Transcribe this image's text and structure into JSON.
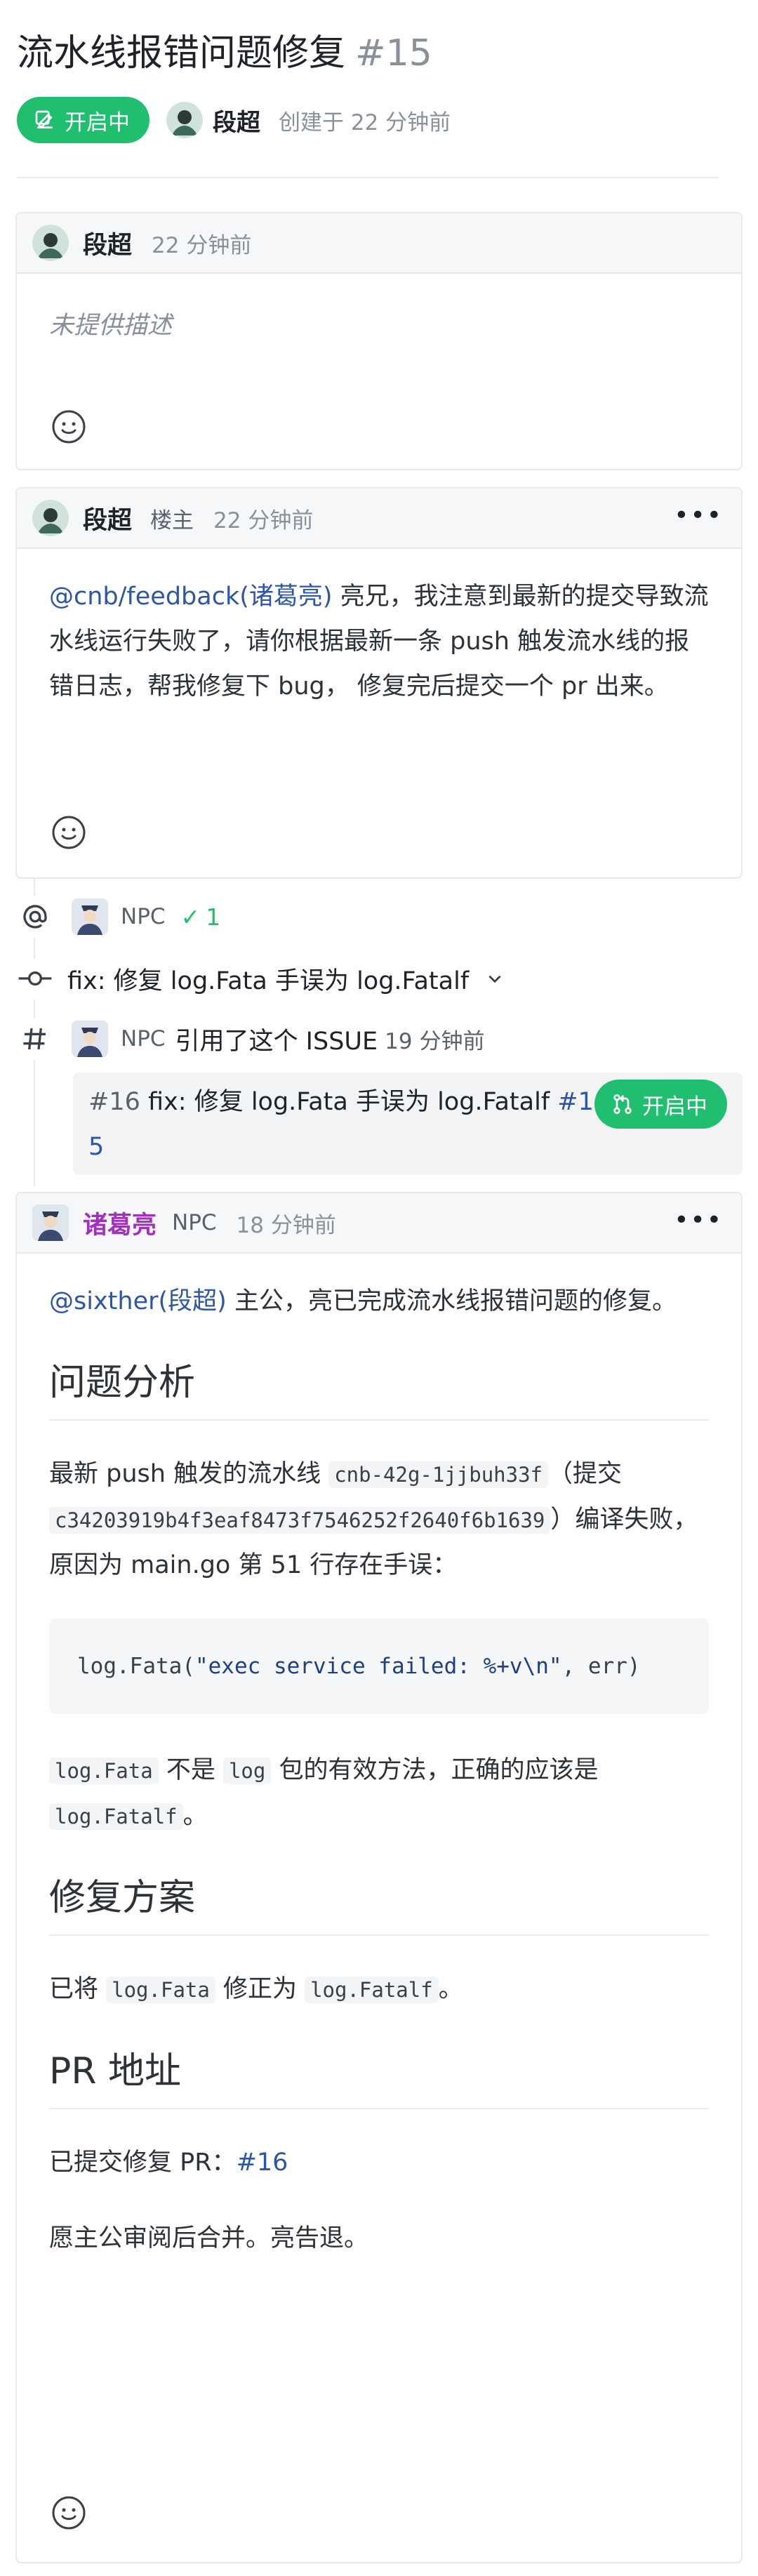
{
  "issue": {
    "title": "流水线报错问题修复",
    "number": "#15",
    "status": "开启中",
    "author": "段超",
    "created": "创建于 22 分钟前"
  },
  "comments": [
    {
      "author": "段超",
      "time": "22 分钟前",
      "body": "未提供描述"
    },
    {
      "author": "段超",
      "tag": "楼主",
      "time": "22 分钟前",
      "mention": "@cnb/feedback(诸葛亮)",
      "body": " 亮兄，我注意到最新的提交导致流水线运行失败了，请你根据最新一条 push 触发流水线的报错日志，帮我修复下 bug， 修复完后提交一个 pr 出来。"
    }
  ],
  "timeline": {
    "assign": {
      "npc": "NPC",
      "count": "1"
    },
    "commit": {
      "message": "fix: 修复 log.Fata 手误为 log.Fatalf"
    },
    "reference": {
      "npc": "NPC",
      "text": "引用了这个 ISSUE",
      "time": "19 分钟前",
      "pr_number": "#16",
      "pr_title": "fix: 修复 log.Fata 手误为 log.Fatalf",
      "issue_ref": "#15",
      "pr_status": "开启中"
    }
  },
  "reply": {
    "author": "诸葛亮",
    "npc": "NPC",
    "time": "18 分钟前",
    "mention": "@sixther(段超)",
    "intro": " 主公，亮已完成流水线报错问题的修复。",
    "h_analysis": "问题分析",
    "p1_a": "最新 push 触发的流水线 ",
    "p1_code1": "cnb-42g-1jjbuh33f",
    "p1_b": "（提交 ",
    "p1_code2": "c34203919b4f3eaf8473f7546252f2640f6b1639",
    "p1_c": "）编译失败，原因为 main.go 第 51 行存在手误：",
    "code_fn": "log.Fata(",
    "code_str": "\"exec service failed: %+v\\n\"",
    "code_rest": ", err)",
    "p2_code1": "log.Fata",
    "p2_a": " 不是 ",
    "p2_code2": "log",
    "p2_b": " 包的有效方法，正确的应该是 ",
    "p2_code3": "log.Fatalf",
    "p2_c": "。",
    "h_fix": "修复方案",
    "p3_a": "已将 ",
    "p3_code1": "log.Fata",
    "p3_b": " 修正为 ",
    "p3_code2": "log.Fatalf",
    "p3_c": "。",
    "h_pr": "PR 地址",
    "p4_a": "已提交修复 PR：",
    "p4_link": "#16",
    "p5": "愿主公审阅后合并。亮告退。"
  },
  "colors": {
    "accent_green": "#1fbf6f",
    "link_blue": "#2e56a6",
    "name_purple": "#a32fbf"
  },
  "icons": [
    "edit-icon",
    "smiley-icon",
    "more-icon",
    "mention-icon",
    "commit-icon",
    "hash-icon",
    "pull-request-icon",
    "chevron-down-icon",
    "check-icon"
  ]
}
